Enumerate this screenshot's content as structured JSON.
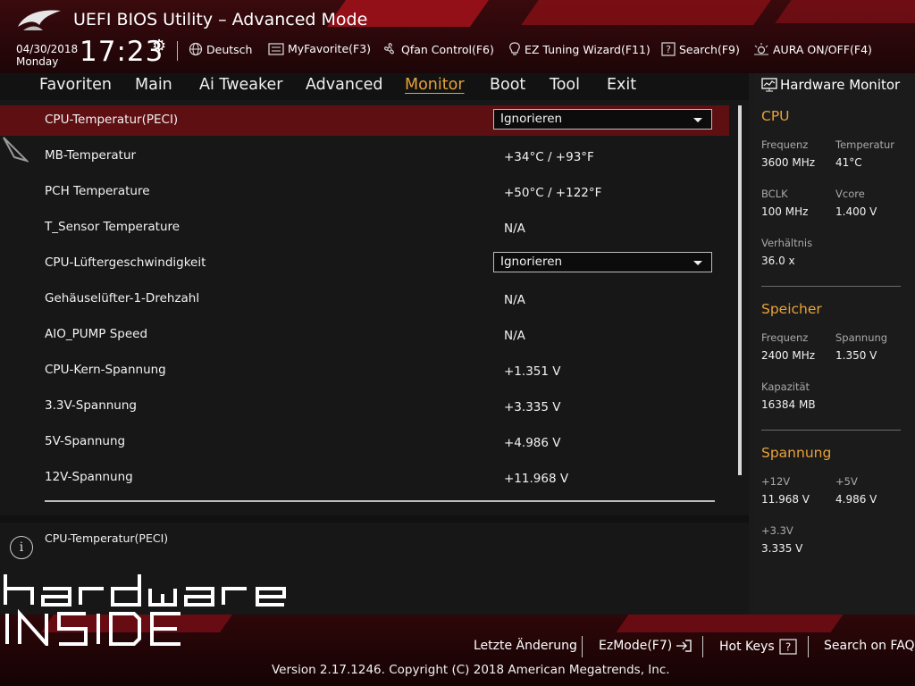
{
  "header": {
    "title": "UEFI BIOS Utility – Advanced Mode",
    "date": "04/30/2018",
    "day": "Monday",
    "time": "17:23",
    "tools": [
      {
        "label": "Deutsch",
        "icon": "globe-icon"
      },
      {
        "label": "MyFavorite(F3)",
        "icon": "favorite-list-icon"
      },
      {
        "label": "Qfan Control(F6)",
        "icon": "fan-icon"
      },
      {
        "label": "EZ Tuning Wizard(F11)",
        "icon": "lightbulb-icon"
      },
      {
        "label": "Search(F9)",
        "icon": "question-box-icon"
      },
      {
        "label": "AURA ON/OFF(F4)",
        "icon": "aura-light-icon"
      }
    ]
  },
  "menu": {
    "items": [
      "Favoriten",
      "Main",
      "Ai Tweaker",
      "Advanced",
      "Monitor",
      "Boot",
      "Tool",
      "Exit"
    ],
    "active": "Monitor"
  },
  "settings": {
    "rows": [
      {
        "label": "CPU-Temperatur(PECI)",
        "value": "Ignorieren",
        "type": "dropdown"
      },
      {
        "label": "MB-Temperatur",
        "value": "+34°C / +93°F",
        "type": "text"
      },
      {
        "label": "PCH Temperature",
        "value": "+50°C / +122°F",
        "type": "text"
      },
      {
        "label": "T_Sensor Temperature",
        "value": "N/A",
        "type": "text"
      },
      {
        "label": "CPU-Lüftergeschwindigkeit",
        "value": "Ignorieren",
        "type": "dropdown"
      },
      {
        "label": "Gehäuselüfter-1-Drehzahl",
        "value": "N/A",
        "type": "text"
      },
      {
        "label": "AIO_PUMP Speed",
        "value": "N/A",
        "type": "text"
      },
      {
        "label": "CPU-Kern-Spannung",
        "value": "+1.351 V",
        "type": "text"
      },
      {
        "label": "3.3V-Spannung",
        "value": "+3.335 V",
        "type": "text"
      },
      {
        "label": "5V-Spannung",
        "value": "+4.986 V",
        "type": "text"
      },
      {
        "label": "12V-Spannung",
        "value": "+11.968 V",
        "type": "text"
      }
    ]
  },
  "help": {
    "text": "CPU-Temperatur(PECI)"
  },
  "hardware_monitor": {
    "title": "Hardware Monitor",
    "cpu": {
      "title": "CPU",
      "freq_label": "Frequenz",
      "freq": "3600 MHz",
      "temp_label": "Temperatur",
      "temp": "41°C",
      "bclk_label": "BCLK",
      "bclk": "100 MHz",
      "vcore_label": "Vcore",
      "vcore": "1.400 V",
      "ratio_label": "Verhältnis",
      "ratio": "36.0 x"
    },
    "memory": {
      "title": "Speicher",
      "freq_label": "Frequenz",
      "freq": "2400 MHz",
      "volt_label": "Spannung",
      "volt": "1.350 V",
      "cap_label": "Kapazität",
      "cap": "16384 MB"
    },
    "voltage": {
      "title": "Spannung",
      "v12_label": "+12V",
      "v12": "11.968 V",
      "v5_label": "+5V",
      "v5": "4.986 V",
      "v33_label": "+3.3V",
      "v33": "3.335 V"
    }
  },
  "footer": {
    "last_change": "Letzte Änderung",
    "ezmode": "EzMode(F7)",
    "hotkeys": "Hot Keys",
    "faq": "Search on FAQ",
    "copyright": "Version 2.17.1246. Copyright (C) 2018 American Megatrends, Inc."
  },
  "watermark": {
    "line1": "hardware",
    "line2": "INSIDE"
  },
  "colors": {
    "accent": "#e8a23a",
    "selected_row": "#5e0f12",
    "header_red": "#a4121b"
  }
}
